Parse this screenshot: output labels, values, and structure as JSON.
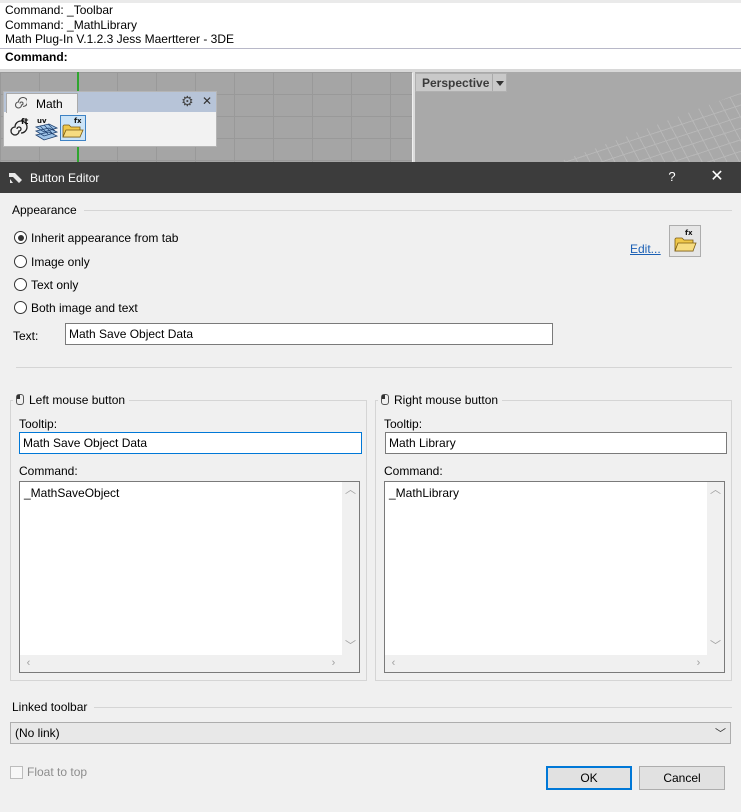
{
  "command_history": {
    "lines": [
      "Command: _Toolbar",
      "Command: _MathLibrary",
      "Math Plug-In V.1.2.3 Jess Maertterer - 3DE"
    ],
    "prompt": "Command:"
  },
  "viewport": {
    "perspective_label": "Perspective"
  },
  "math_toolbar": {
    "tab_label": "Math",
    "buttons": [
      "ft",
      "uv",
      "fx"
    ]
  },
  "dialog": {
    "title": "Button Editor",
    "help": "?",
    "close": "✕",
    "appearance": {
      "group_label": "Appearance",
      "options": [
        {
          "label": "Inherit appearance from tab",
          "selected": true
        },
        {
          "label": "Image only",
          "selected": false
        },
        {
          "label": "Text only",
          "selected": false
        },
        {
          "label": "Both image and text",
          "selected": false
        }
      ],
      "edit_link": "Edit...",
      "text_label": "Text:",
      "text_value": "Math Save Object Data"
    },
    "left_mouse": {
      "group_label": "Left mouse button",
      "tooltip_label": "Tooltip:",
      "tooltip_value": "Math Save Object Data",
      "command_label": "Command:",
      "command_value": "_MathSaveObject"
    },
    "right_mouse": {
      "group_label": "Right mouse button",
      "tooltip_label": "Tooltip:",
      "tooltip_value": "Math Library",
      "command_label": "Command:",
      "command_value": "_MathLibrary"
    },
    "linked_toolbar": {
      "group_label": "Linked toolbar",
      "selected": "(No link)"
    },
    "float_to_top": {
      "label": "Float to top",
      "checked": false,
      "enabled": false
    },
    "ok_label": "OK",
    "cancel_label": "Cancel"
  },
  "colors": {
    "title_bar": "#3c3c3c",
    "accent": "#0078d7",
    "link": "#1a5fb4"
  }
}
